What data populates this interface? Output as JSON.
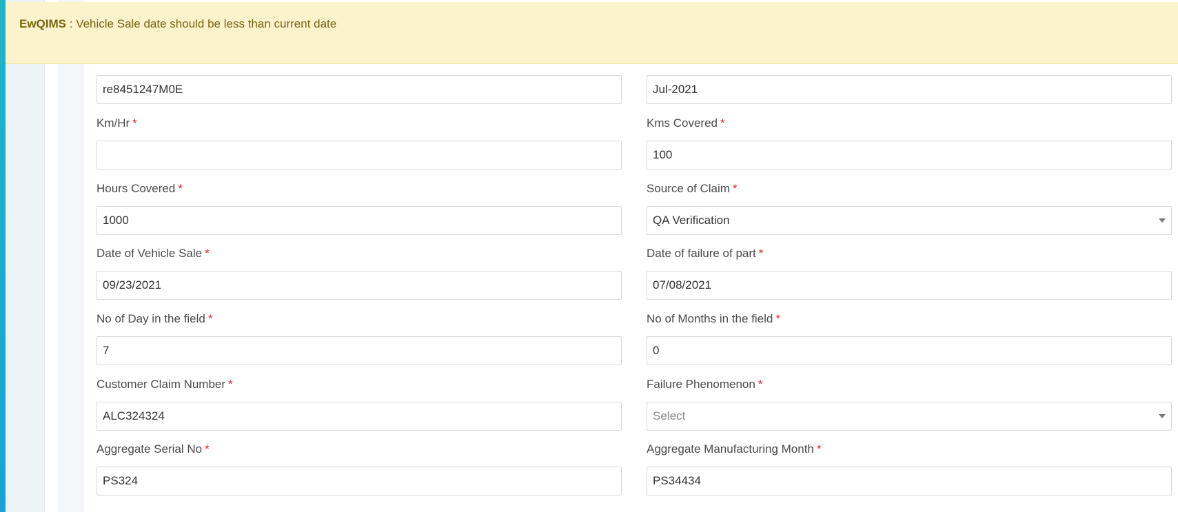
{
  "alert": {
    "brand": "EwQIMS",
    "separator": " : ",
    "message": "Vehicle Sale date should be less than current date"
  },
  "fields_top": {
    "left_value": "re8451247M0E",
    "right_value": "Jul-2021"
  },
  "fields": {
    "km_hr": {
      "label": "Km/Hr",
      "value": ""
    },
    "kms_covered": {
      "label": "Kms Covered",
      "value": "100"
    },
    "hours_covered": {
      "label": "Hours Covered",
      "value": "1000"
    },
    "source_of_claim": {
      "label": "Source of Claim",
      "value": "QA Verification"
    },
    "date_vehicle_sale": {
      "label": "Date of Vehicle Sale",
      "value": "09/23/2021"
    },
    "date_failure_part": {
      "label": "Date of failure of part",
      "value": "07/08/2021"
    },
    "days_in_field": {
      "label": "No of Day in the field",
      "value": "7"
    },
    "months_in_field": {
      "label": "No of Months in the field",
      "value": "0"
    },
    "customer_claim_number": {
      "label": "Customer Claim Number",
      "value": "ALC324324"
    },
    "failure_phenomenon": {
      "label": "Failure Phenomenon",
      "placeholder": "Select"
    },
    "aggregate_serial_no": {
      "label": "Aggregate Serial No",
      "value": "PS324"
    },
    "aggregate_mfg_month": {
      "label": "Aggregate Manufacturing Month",
      "value": "PS34434"
    }
  },
  "required_mark": "*"
}
